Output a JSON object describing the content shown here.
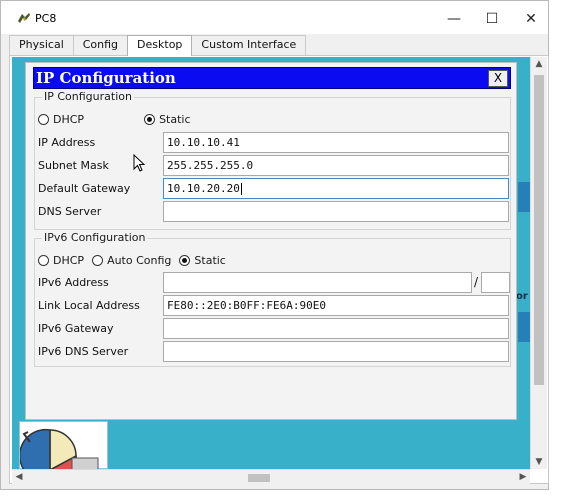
{
  "window": {
    "title": "PC8",
    "minimize": "—",
    "maximize": "☐",
    "close": "✕"
  },
  "tabs": [
    {
      "label": "Physical",
      "active": false
    },
    {
      "label": "Config",
      "active": false
    },
    {
      "label": "Desktop",
      "active": true
    },
    {
      "label": "Custom Interface",
      "active": false
    }
  ],
  "desktop": {
    "background_color": "#39b0c9",
    "partial_label": "or"
  },
  "ip_config": {
    "header_title": "IP Configuration",
    "close_label": "X",
    "ipv4": {
      "legend": "IP Configuration",
      "mode_options": [
        "DHCP",
        "Static"
      ],
      "selected_mode": "Static",
      "fields": {
        "ip_address": {
          "label": "IP Address",
          "value": "10.10.10.41"
        },
        "subnet_mask": {
          "label": "Subnet Mask",
          "value": "255.255.255.0"
        },
        "default_gateway": {
          "label": "Default Gateway",
          "value": "10.10.20.20"
        },
        "dns_server": {
          "label": "DNS Server",
          "value": ""
        }
      }
    },
    "ipv6": {
      "legend": "IPv6 Configuration",
      "mode_options": [
        "DHCP",
        "Auto Config",
        "Static"
      ],
      "selected_mode": "Static",
      "fields": {
        "ipv6_address": {
          "label": "IPv6 Address",
          "value": "",
          "prefix_separator": "/",
          "prefix": ""
        },
        "link_local": {
          "label": "Link Local Address",
          "value": "FE80::2E0:B0FF:FE6A:90E0"
        },
        "ipv6_gateway": {
          "label": "IPv6 Gateway",
          "value": ""
        },
        "ipv6_dns": {
          "label": "IPv6 DNS Server",
          "value": ""
        }
      }
    }
  },
  "scrollbars": {
    "up_arrow": "▲",
    "down_arrow": "▼",
    "left_arrow": "◀",
    "right_arrow": "▶"
  },
  "colors": {
    "header_blue": "#0b0bf1",
    "desktop_teal": "#39b0c9",
    "strip_blue": "#2680b8"
  }
}
